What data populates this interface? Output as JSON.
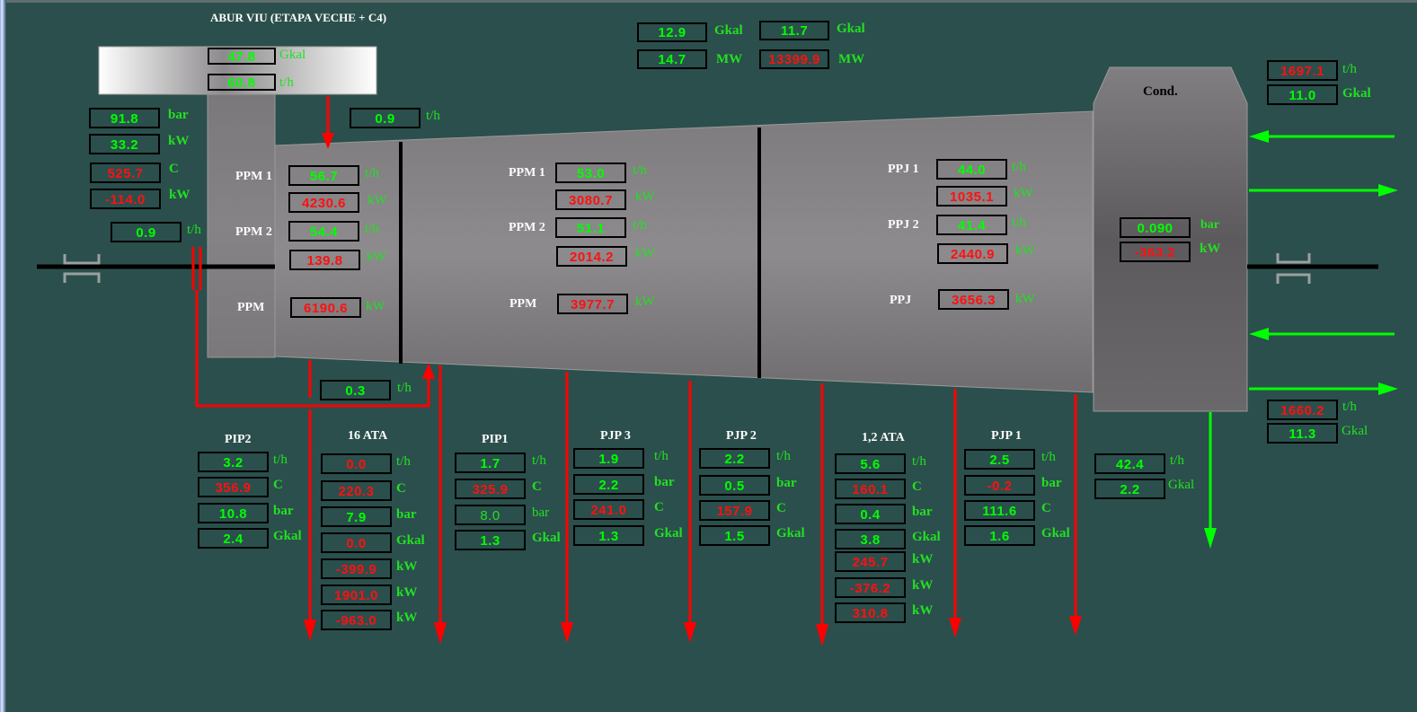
{
  "title": "ABUR VIU (ETAPA VECHE + C4)",
  "colors": {
    "background": "#2b4f4c",
    "ok": "#00ff00",
    "alarm": "#ff1010",
    "steam_line": "#ff0000",
    "water_line": "#00ff00"
  },
  "header": {
    "live_steam_gkal": {
      "value": "47.8",
      "unit": "Gkal",
      "status": "ok"
    },
    "live_steam_flow": {
      "value": "60.8",
      "unit": "t/h",
      "status": "ok"
    },
    "total_1_gkal": {
      "value": "12.9",
      "unit": "Gkal",
      "status": "ok"
    },
    "total_1_mw": {
      "value": "14.7",
      "unit": "MW",
      "status": "ok"
    },
    "total_2_gkal": {
      "value": "11.7",
      "unit": "Gkal",
      "status": "ok"
    },
    "total_2_mw": {
      "value": "13399.9",
      "unit": "MW",
      "status": "alarm"
    }
  },
  "inlet": {
    "pressure": {
      "value": "91.8",
      "unit": "bar",
      "status": "ok"
    },
    "power": {
      "value": "33.2",
      "unit": "kW",
      "status": "ok"
    },
    "temperature": {
      "value": "525.7",
      "unit": "C",
      "status": "alarm"
    },
    "power_2": {
      "value": "-114.0",
      "unit": "kW",
      "status": "alarm"
    },
    "leak_flow": {
      "value": "0.9",
      "unit": "t/h",
      "status": "ok"
    },
    "top_leak_flow": {
      "value": "0.9",
      "unit": "t/h",
      "status": "ok"
    },
    "bypass_flow": {
      "value": "0.3",
      "unit": "t/h",
      "status": "ok"
    }
  },
  "stage_1": {
    "rows": [
      {
        "label": "PPM 1",
        "value": "56.7",
        "unit": "t/h",
        "status": "ok"
      },
      {
        "label": "",
        "value": "4230.6",
        "unit": "kW",
        "status": "alarm"
      },
      {
        "label": "PPM 2",
        "value": "54.4",
        "unit": "t/h",
        "status": "ok"
      },
      {
        "label": "",
        "value": "139.8",
        "unit": "kW",
        "status": "alarm"
      },
      {
        "label": "PPM",
        "value": "6190.6",
        "unit": "kW",
        "status": "alarm"
      }
    ]
  },
  "stage_2": {
    "rows": [
      {
        "label": "PPM 1",
        "value": "53.0",
        "unit": "t/h",
        "status": "ok"
      },
      {
        "label": "",
        "value": "3080.7",
        "unit": "kW",
        "status": "alarm"
      },
      {
        "label": "PPM 2",
        "value": "51.1",
        "unit": "t/h",
        "status": "ok"
      },
      {
        "label": "",
        "value": "2014.2",
        "unit": "kW",
        "status": "alarm"
      },
      {
        "label": "PPM",
        "value": "3977.7",
        "unit": "kW",
        "status": "alarm"
      }
    ]
  },
  "stage_3": {
    "rows": [
      {
        "label": "PPJ 1",
        "value": "44.0",
        "unit": "t/h",
        "status": "ok"
      },
      {
        "label": "",
        "value": "1035.1",
        "unit": "kW",
        "status": "alarm"
      },
      {
        "label": "PPJ 2",
        "value": "41.4",
        "unit": "t/h",
        "status": "ok"
      },
      {
        "label": "",
        "value": "2440.9",
        "unit": "kW",
        "status": "alarm"
      },
      {
        "label": "PPJ",
        "value": "3656.3",
        "unit": "kW",
        "status": "alarm"
      }
    ]
  },
  "condenser": {
    "label": "Cond.",
    "pressure": {
      "value": "0.090",
      "unit": "bar",
      "status": "ok"
    },
    "power": {
      "value": "-363.2",
      "unit": "kW",
      "status": "alarm"
    },
    "cooling_in_flow": {
      "value": "1697.1",
      "unit": "t/h",
      "status": "alarm"
    },
    "cooling_in_gkal": {
      "value": "11.0",
      "unit": "Gkal",
      "status": "ok"
    },
    "cooling_out_flow": {
      "value": "1660.2",
      "unit": "t/h",
      "status": "alarm"
    },
    "cooling_out_gkal": {
      "value": "11.3",
      "unit": "Gkal",
      "status": "ok"
    },
    "condensate_flow": {
      "value": "42.4",
      "unit": "t/h",
      "status": "ok"
    },
    "condensate_gkal": {
      "value": "2.2",
      "unit": "Gkal",
      "status": "ok"
    }
  },
  "extractions": [
    {
      "name": "PIP2",
      "rows": [
        {
          "value": "3.2",
          "unit": "t/h",
          "status": "ok"
        },
        {
          "value": "356.9",
          "unit": "C",
          "status": "alarm"
        },
        {
          "value": "10.8",
          "unit": "bar",
          "status": "ok"
        },
        {
          "value": "2.4",
          "unit": "Gkal",
          "status": "ok"
        }
      ]
    },
    {
      "name": "16 ATA",
      "rows": [
        {
          "value": "0.0",
          "unit": "t/h",
          "status": "alarm"
        },
        {
          "value": "220.3",
          "unit": "C",
          "status": "alarm"
        },
        {
          "value": "7.9",
          "unit": "bar",
          "status": "ok"
        },
        {
          "value": "0.0",
          "unit": "Gkal",
          "status": "alarm"
        },
        {
          "value": "-399.9",
          "unit": "kW",
          "status": "alarm"
        },
        {
          "value": "1901.0",
          "unit": "kW",
          "status": "alarm"
        },
        {
          "value": "-963.0",
          "unit": "kW",
          "status": "alarm"
        }
      ]
    },
    {
      "name": "PIP1",
      "rows": [
        {
          "value": "1.7",
          "unit": "t/h",
          "status": "ok"
        },
        {
          "value": "325.9",
          "unit": "C",
          "status": "alarm"
        },
        {
          "value": "8.0",
          "unit": "bar",
          "status": "thin"
        },
        {
          "value": "1.3",
          "unit": "Gkal",
          "status": "ok"
        }
      ]
    },
    {
      "name": "PJP 3",
      "rows": [
        {
          "value": "1.9",
          "unit": "t/h",
          "status": "ok"
        },
        {
          "value": "2.2",
          "unit": "bar",
          "status": "ok"
        },
        {
          "value": "241.0",
          "unit": "C",
          "status": "alarm"
        },
        {
          "value": "1.3",
          "unit": "Gkal",
          "status": "ok"
        }
      ]
    },
    {
      "name": "PJP 2",
      "rows": [
        {
          "value": "2.2",
          "unit": "t/h",
          "status": "ok"
        },
        {
          "value": "0.5",
          "unit": "bar",
          "status": "ok"
        },
        {
          "value": "157.9",
          "unit": "C",
          "status": "alarm"
        },
        {
          "value": "1.5",
          "unit": "Gkal",
          "status": "ok"
        }
      ]
    },
    {
      "name": "1,2 ATA",
      "rows": [
        {
          "value": "5.6",
          "unit": "t/h",
          "status": "ok"
        },
        {
          "value": "160.1",
          "unit": "C",
          "status": "alarm"
        },
        {
          "value": "0.4",
          "unit": "bar",
          "status": "ok"
        },
        {
          "value": "3.8",
          "unit": "Gkal",
          "status": "ok"
        },
        {
          "value": "245.7",
          "unit": "kW",
          "status": "alarm"
        },
        {
          "value": "-376.2",
          "unit": "kW",
          "status": "alarm"
        },
        {
          "value": "310.8",
          "unit": "kW",
          "status": "alarm"
        }
      ]
    },
    {
      "name": "PJP 1",
      "rows": [
        {
          "value": "2.5",
          "unit": "t/h",
          "status": "ok"
        },
        {
          "value": "-0.2",
          "unit": "bar",
          "status": "alarm"
        },
        {
          "value": "111.6",
          "unit": "C",
          "status": "ok"
        },
        {
          "value": "1.6",
          "unit": "Gkal",
          "status": "ok"
        }
      ]
    }
  ]
}
